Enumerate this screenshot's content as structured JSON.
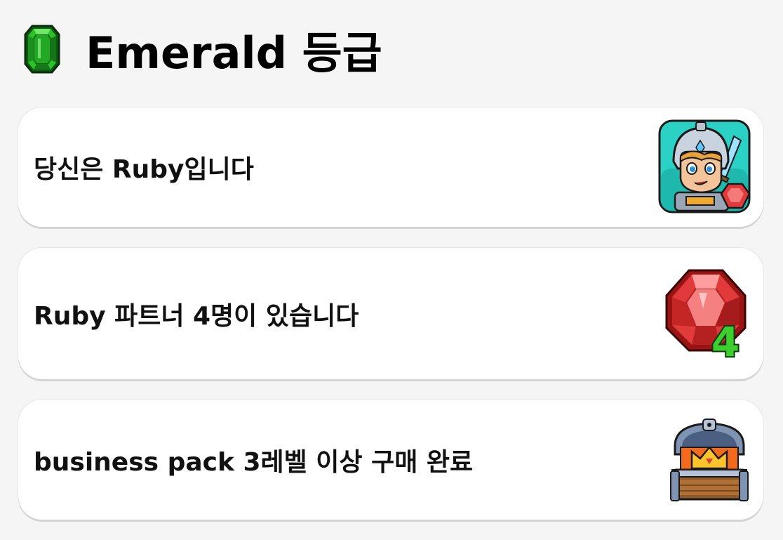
{
  "header": {
    "title": "Emerald 등급",
    "icon": "emerald-gem-icon",
    "gem_color": "#22b022"
  },
  "requirements": [
    {
      "label": "당신은 Ruby입니다",
      "icon": "ruby-knight-avatar-icon"
    },
    {
      "label": "Ruby 파트너 4명이 있습니다",
      "icon": "ruby-gem-icon",
      "badge": "4"
    },
    {
      "label": "business pack 3레벨 이상 구매 완료",
      "icon": "treasure-chest-icon"
    }
  ],
  "colors": {
    "ruby": "#e03a3a",
    "badge_green": "#3ccf2e",
    "avatar_bg": "#2bd1c4"
  }
}
